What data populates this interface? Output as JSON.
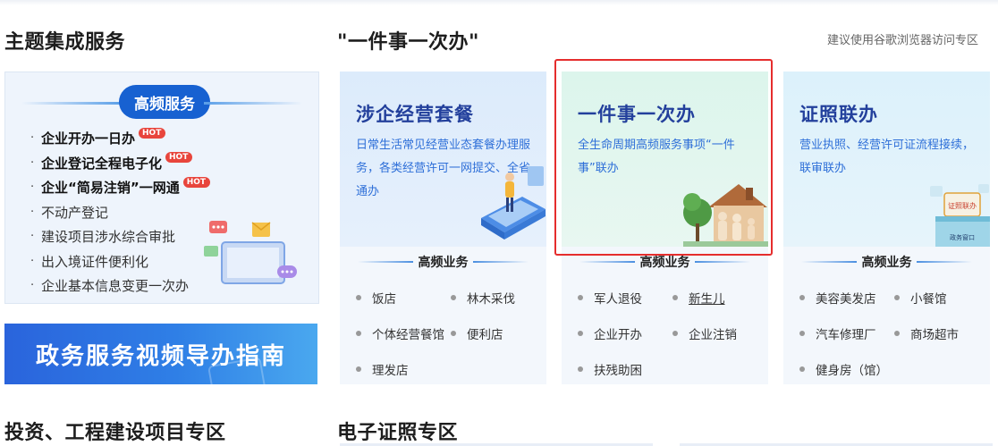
{
  "headers": {
    "theme_service": "主题集成服务",
    "one_thing": "\"一件事一次办\"",
    "browser_hint": "建议使用谷歌浏览器访问专区",
    "investment": "投资、工程建设项目专区",
    "e_license": "电子证照专区"
  },
  "high_freq": {
    "badge": "高频服务",
    "hot_label": "HOT",
    "items": [
      {
        "label": "企业开办一日办",
        "bold": true,
        "hot": true
      },
      {
        "label": "企业登记全程电子化",
        "bold": true,
        "hot": true
      },
      {
        "label": "企业“简易注销”一网通",
        "bold": true,
        "hot": true
      },
      {
        "label": "不动产登记",
        "bold": false,
        "hot": false
      },
      {
        "label": "建设项目涉水综合审批",
        "bold": false,
        "hot": false
      },
      {
        "label": "出入境证件便利化",
        "bold": false,
        "hot": false
      },
      {
        "label": "企业基本信息变更一次办",
        "bold": false,
        "hot": false
      }
    ]
  },
  "video_banner": "政务服务视频导办指南",
  "cards": [
    {
      "title": "涉企经营套餐",
      "desc": "日常生活常见经营业态套餐办理服务，各类经营许可一网提交、全省通办",
      "sub_title": "高频业务",
      "items": [
        "饭店",
        "林木采伐",
        "个体经营餐馆",
        "便利店",
        "理发店"
      ]
    },
    {
      "title": "一件事一次办",
      "desc": "全生命周期高频服务事项“一件事”联办",
      "sub_title": "高频业务",
      "items": [
        "军人退役",
        "新生儿",
        "企业开办",
        "企业注销",
        "扶残助困"
      ]
    },
    {
      "title": "证照联办",
      "desc": "营业执照、经营许可证流程接续，联审联办",
      "sub_title": "高频业务",
      "items": [
        "美容美发店",
        "小餐馆",
        "汽车修理厂",
        "商场超市",
        "健身房（馆）"
      ],
      "sign_top": "证照联办",
      "sign_bottom": "政务窗口"
    }
  ],
  "colors": {
    "accent_blue": "#1761d1",
    "title_blue": "#23409c",
    "desc_blue": "#2e6fd8",
    "hot_red": "#e8453c",
    "highlight_red": "#e52d2d"
  }
}
